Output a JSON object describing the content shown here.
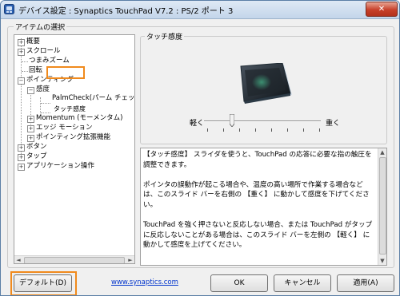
{
  "window": {
    "title": "デバイス設定 : Synaptics TouchPad V7.2 : PS/2 ポート 3",
    "close_glyph": "✕"
  },
  "items_group": {
    "label": "アイテムの選択"
  },
  "tree": {
    "items": [
      {
        "label": "概要",
        "toggle": "+"
      },
      {
        "label": "スクロール",
        "toggle": "+"
      },
      {
        "label": "つまみズーム",
        "toggle": ""
      },
      {
        "label": "回転",
        "toggle": ""
      },
      {
        "label": "ポインティング",
        "toggle": "−"
      },
      {
        "label": "感度",
        "toggle": "−"
      },
      {
        "label": "PalmCheck(パーム チェック)",
        "toggle": ""
      },
      {
        "label": "タッチ感度",
        "toggle": "",
        "selected": true
      },
      {
        "label": "Momentum (モーメンタム)",
        "toggle": "+"
      },
      {
        "label": "エッジ モーション",
        "toggle": "+"
      },
      {
        "label": "ポインティング拡張機能",
        "toggle": "+"
      },
      {
        "label": "ボタン",
        "toggle": "+"
      },
      {
        "label": "タップ",
        "toggle": "+"
      },
      {
        "label": "アプリケーション操作",
        "toggle": "+"
      }
    ],
    "scroll_left": "◄",
    "scroll_right": "►"
  },
  "touch_group": {
    "label": "タッチ感度",
    "slider_min_label": "軽く",
    "slider_max_label": "重く",
    "slider_value": 0.22,
    "tick_count": 8
  },
  "description": {
    "paragraphs": [
      "【タッチ感度】 スライダを使うと、TouchPad の応答に必要な指の触圧を調整できます。",
      "ポインタの誤動作が起こる場合や、温度の高い場所で作業する場合などは、このスライド バーを右側の 【重く】 に動かして感度を下げてください。",
      "TouchPad を強く押さないと反応しない場合、または TouchPad がタップに反応しないことがある場合は、このスライド バーを左側の 【軽く】 に動かして感度を上げてください。"
    ],
    "scroll_up": "▲",
    "scroll_down": "▼"
  },
  "footer": {
    "default_button": "デフォルト(D)",
    "link": "www.synaptics.com",
    "ok_button": "OK",
    "cancel_button": "キャンセル",
    "apply_button": "適用(A)"
  },
  "colors": {
    "highlight": "#f08a1d",
    "link": "#0033cc",
    "close_button": "#c7402a"
  }
}
